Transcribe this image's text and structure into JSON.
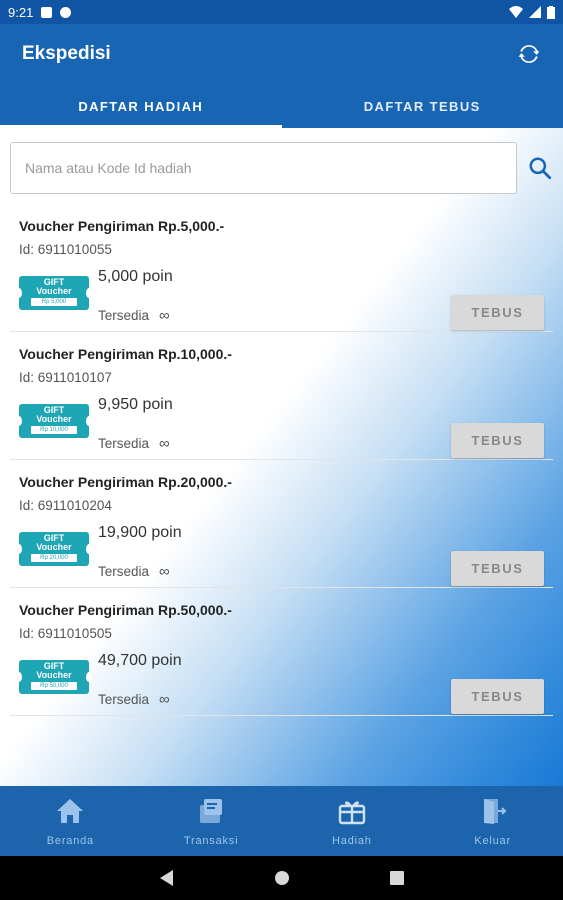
{
  "status_bar": {
    "time": "9:21"
  },
  "app_bar": {
    "title": "Ekspedisi",
    "action_icon": "refresh-icon"
  },
  "tabs": [
    {
      "label": "DAFTAR HADIAH",
      "active": true
    },
    {
      "label": "DAFTAR TEBUS",
      "active": false
    }
  ],
  "search": {
    "placeholder": "Nama atau Kode Id hadiah",
    "value": ""
  },
  "rewards": [
    {
      "name": "Voucher Pengiriman Rp.5,000.-",
      "id": "Id: 6911010055",
      "points": "5,000 poin",
      "availability": "Tersedia",
      "stock": "∞",
      "button": "TEBUS",
      "image_text": {
        "line1": "GIFT",
        "line2": "Voucher",
        "amount": "Rp 5,000"
      }
    },
    {
      "name": "Voucher Pengiriman Rp.10,000.-",
      "id": "Id: 6911010107",
      "points": "9,950 poin",
      "availability": "Tersedia",
      "stock": "∞",
      "button": "TEBUS",
      "image_text": {
        "line1": "GIFT",
        "line2": "Voucher",
        "amount": "Rp 10,000"
      }
    },
    {
      "name": "Voucher Pengiriman Rp.20,000.-",
      "id": "Id: 6911010204",
      "points": "19,900 poin",
      "availability": "Tersedia",
      "stock": "∞",
      "button": "TEBUS",
      "image_text": {
        "line1": "GIFT",
        "line2": "Voucher",
        "amount": "Rp 20,000"
      }
    },
    {
      "name": "Voucher Pengiriman Rp.50,000.-",
      "id": "Id: 6911010505",
      "points": "49,700 poin",
      "availability": "Tersedia",
      "stock": "∞",
      "button": "TEBUS",
      "image_text": {
        "line1": "GIFT",
        "line2": "Voucher",
        "amount": "Rp 50,000"
      }
    }
  ],
  "bottom_nav": [
    {
      "label": "Beranda",
      "icon": "home-icon"
    },
    {
      "label": "Transaksi",
      "icon": "transaction-icon"
    },
    {
      "label": "Hadiah",
      "icon": "gift-icon"
    },
    {
      "label": "Keluar",
      "icon": "logout-icon"
    }
  ],
  "colors": {
    "primary": "#1765b3",
    "status_bar": "#0f55a4",
    "voucher": "#1fa6b5",
    "nav_label": "#9ec3ea"
  }
}
